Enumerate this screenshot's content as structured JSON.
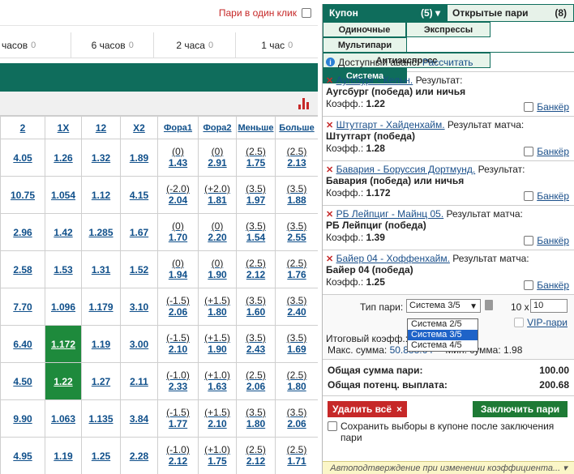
{
  "header": {
    "one_click_label": "Пари в один клик"
  },
  "periods": [
    {
      "label": "часов",
      "count": "0"
    },
    {
      "label": "6 часов",
      "count": "0"
    },
    {
      "label": "2 часа",
      "count": "0"
    },
    {
      "label": "1 час",
      "count": "0"
    }
  ],
  "table": {
    "headers": [
      "2",
      "1X",
      "12",
      "X2",
      "Фора1",
      "Фора2",
      "Меньше",
      "Больше"
    ],
    "rows": [
      {
        "c2": "4.05",
        "c1x": "1.26",
        "c12": "1.32",
        "cx2": "1.89",
        "f1l": "(0)",
        "f1": "1.43",
        "f2l": "(0)",
        "f2": "2.91",
        "ml": "(2.5)",
        "m": "1.75",
        "bl": "(2.5)",
        "b": "2.13"
      },
      {
        "c2": "10.75",
        "c1x": "1.054",
        "c12": "1.12",
        "cx2": "4.15",
        "f1l": "(-2.0)",
        "f1": "2.04",
        "f2l": "(+2.0)",
        "f2": "1.81",
        "ml": "(3.5)",
        "m": "1.97",
        "bl": "(3.5)",
        "b": "1.88"
      },
      {
        "c2": "2.96",
        "c1x": "1.42",
        "c12": "1.285",
        "cx2": "1.67",
        "f1l": "(0)",
        "f1": "1.70",
        "f2l": "(0)",
        "f2": "2.20",
        "ml": "(3.5)",
        "m": "1.54",
        "bl": "(3.5)",
        "b": "2.55"
      },
      {
        "c2": "2.58",
        "c1x": "1.53",
        "c12": "1.31",
        "cx2": "1.52",
        "f1l": "(0)",
        "f1": "1.94",
        "f2l": "(0)",
        "f2": "1.90",
        "ml": "(2.5)",
        "m": "2.12",
        "bl": "(2.5)",
        "b": "1.76"
      },
      {
        "c2": "7.70",
        "c1x": "1.096",
        "c12": "1.179",
        "cx2": "3.10",
        "f1l": "(-1.5)",
        "f1": "2.06",
        "f2l": "(+1.5)",
        "f2": "1.80",
        "ml": "(3.5)",
        "m": "1.60",
        "bl": "(3.5)",
        "b": "2.40"
      },
      {
        "c2": "6.40",
        "c1x": "1.172",
        "c12": "1.19",
        "cx2": "3.00",
        "f1l": "(-1.5)",
        "f1": "2.10",
        "f2l": "(+1.5)",
        "f2": "1.90",
        "ml": "(3.5)",
        "m": "2.43",
        "bl": "(3.5)",
        "b": "1.69"
      },
      {
        "c2": "4.50",
        "c1x": "1.22",
        "c12": "1.27",
        "cx2": "2.11",
        "f1l": "(-1.0)",
        "f1": "2.33",
        "f2l": "(+1.0)",
        "f2": "1.63",
        "ml": "(2.5)",
        "m": "2.06",
        "bl": "(2.5)",
        "b": "1.80"
      },
      {
        "c2": "9.90",
        "c1x": "1.063",
        "c12": "1.135",
        "cx2": "3.84",
        "f1l": "(-1.5)",
        "f1": "1.77",
        "f2l": "(+1.5)",
        "f2": "2.10",
        "ml": "(3.5)",
        "m": "1.80",
        "bl": "(3.5)",
        "b": "2.06"
      },
      {
        "c2": "4.95",
        "c1x": "1.19",
        "c12": "1.25",
        "cx2": "2.28",
        "f1l": "(-1.0)",
        "f1": "2.12",
        "f2l": "(+1.0)",
        "f2": "1.75",
        "ml": "(2.5)",
        "m": "2.12",
        "bl": "(2.5)",
        "b": "1.71"
      }
    ],
    "highlighted_rows": [
      5,
      6
    ],
    "highlight_color": "#1e8a3c"
  },
  "coupon": {
    "tab_label": "Купон",
    "tab_count": "(5)",
    "open_label": "Открытые пари",
    "open_count": "(8)",
    "types": [
      "Одиночные",
      "Экспрессы",
      "Мультипари",
      "Антиэкспресс",
      "Система"
    ],
    "advance_label": "Доступный аванс:",
    "advance_link": "Рассчитать",
    "bets": [
      {
        "match": "Аугсбург - Кельн.",
        "result_label": "Результат:",
        "selection": "Аугсбург (победа) или ничья",
        "coef_label": "Коэфф.:",
        "coef": "1.22"
      },
      {
        "match": "Штутгарт - Хайденхайм.",
        "result_label": "Результат матча:",
        "selection": "Штутгарт (победа)",
        "coef_label": "Коэфф.:",
        "coef": "1.28"
      },
      {
        "match": "Бавария - Боруссия Дортмунд.",
        "result_label": "Результат:",
        "selection": "Бавария (победа) или ничья",
        "coef_label": "Коэфф.:",
        "coef": "1.172"
      },
      {
        "match": "РБ Лейпциг - Майнц 05.",
        "result_label": "Результат матча:",
        "selection": "РБ Лейпциг (победа)",
        "coef_label": "Коэфф.:",
        "coef": "1.39"
      },
      {
        "match": "Байер 04 - Хоффенхайм.",
        "result_label": "Результат матча:",
        "selection": "Байер 04 (победа)",
        "coef_label": "Коэфф.:",
        "coef": "1.25"
      }
    ],
    "banker_label": "Банкёр",
    "system": {
      "type_label": "Тип пари:",
      "selected": "Система 3/5",
      "options": [
        "Система 2/5",
        "Система 3/5",
        "Система 4/5"
      ],
      "multiplier_prefix": "10 x",
      "multiplier_value": "10",
      "vip_label": "VIP-пари",
      "itog_label": "Итоговый коэфф.:",
      "max_label": "Макс. сумма:",
      "max_value": "50.833.64",
      "min_label": "Мин. сумма:",
      "min_value": "1.98"
    },
    "total_label": "Общая сумма пари:",
    "total_value": "100.00",
    "payout_label": "Общая потенц. выплата:",
    "payout_value": "200.68",
    "delete_label": "Удалить всё",
    "place_label": "Заключить пари",
    "save_label": "Сохранить выборы в купоне после заключения пари",
    "autoconfirm_label": "Автоподтверждение при изменении коэффициента..."
  }
}
